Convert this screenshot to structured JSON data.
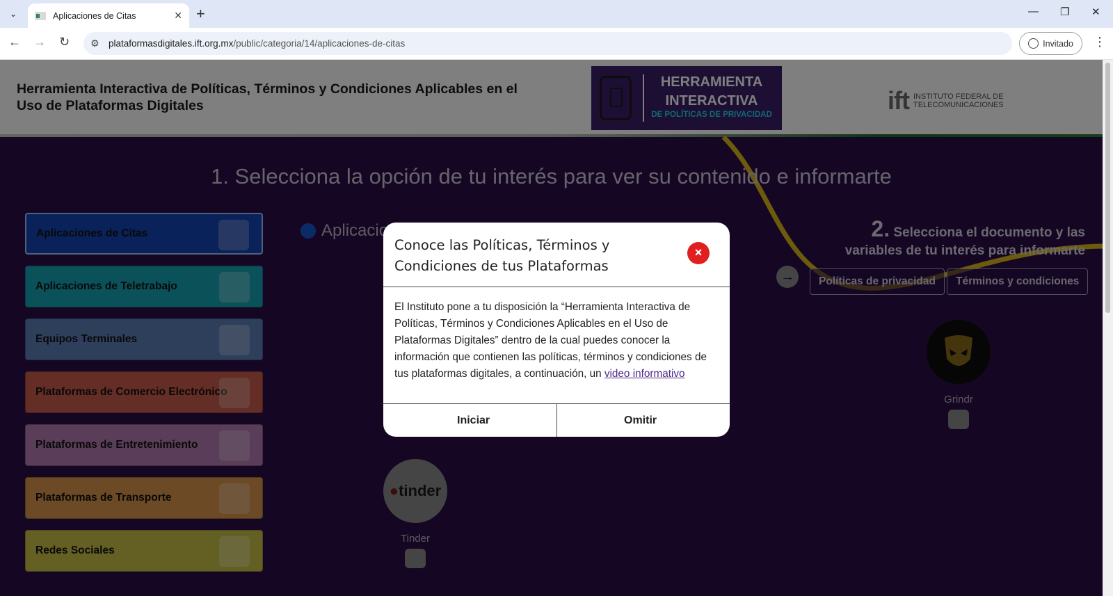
{
  "browser": {
    "tab_title": "Aplicaciones de Citas",
    "url_host": "plataformasdigitales.ift.org.mx",
    "url_path": "/public/categoria/14/aplicaciones-de-citas",
    "profile_label": "Invitado"
  },
  "header": {
    "site_title": "Herramienta Interactiva de Políticas, Términos y Condiciones Aplicables en el Uso de Plataformas Digitales",
    "banner_line1": "HERRAMIENTA",
    "banner_line2": "INTERACTIVA",
    "banner_line3": "DE POLÍTICAS DE PRIVACIDAD",
    "ift_mark": "ift",
    "ift_line1": "INSTITUTO FEDERAL DE",
    "ift_line2": "TELECOMUNICACIONES"
  },
  "main": {
    "step1_title": "1. Selecciona la opción de tu interés para ver su contenido e informarte",
    "section_heading": "Aplicacio",
    "step2_num": "2.",
    "step2_text_1": "Selecciona el documento y las",
    "step2_text_2": "variables de tu interés para informarte",
    "doc_buttons": [
      "Políticas de privacidad",
      "Términos y condiciones"
    ]
  },
  "categories": [
    {
      "label": "Aplicaciones de Citas",
      "color": "#1345b3"
    },
    {
      "label": "Aplicaciones de Teletrabajo",
      "color": "#17a3b4"
    },
    {
      "label": "Equipos Terminales",
      "color": "#5d7eb8"
    },
    {
      "label": "Plataformas de Comercio Electrónico",
      "color": "#c95a4a"
    },
    {
      "label": "Plataformas de Entretenimiento",
      "color": "#b57ab3"
    },
    {
      "label": "Plataformas de Transporte",
      "color": "#d7944a"
    },
    {
      "label": "Redes Sociales",
      "color": "#c9c048"
    }
  ],
  "apps": [
    {
      "name": "Grindr"
    },
    {
      "name": "Tinder",
      "logo_text": "tinder"
    }
  ],
  "modal": {
    "title": "Conoce las Políticas, Términos y Condiciones de tus Plataformas",
    "body": "El Instituto pone a tu disposición la “Herramienta Interactiva de Políticas, Términos y Condiciones Aplicables en el Uso de Plataformas Digitales” dentro de la cual puedes conocer la información que contienen las políticas, términos y condiciones de tus plataformas digitales, a continuación, un ",
    "link": "video informativo",
    "start_button": "Iniciar",
    "skip_button": "Omitir",
    "close_glyph": "×"
  }
}
